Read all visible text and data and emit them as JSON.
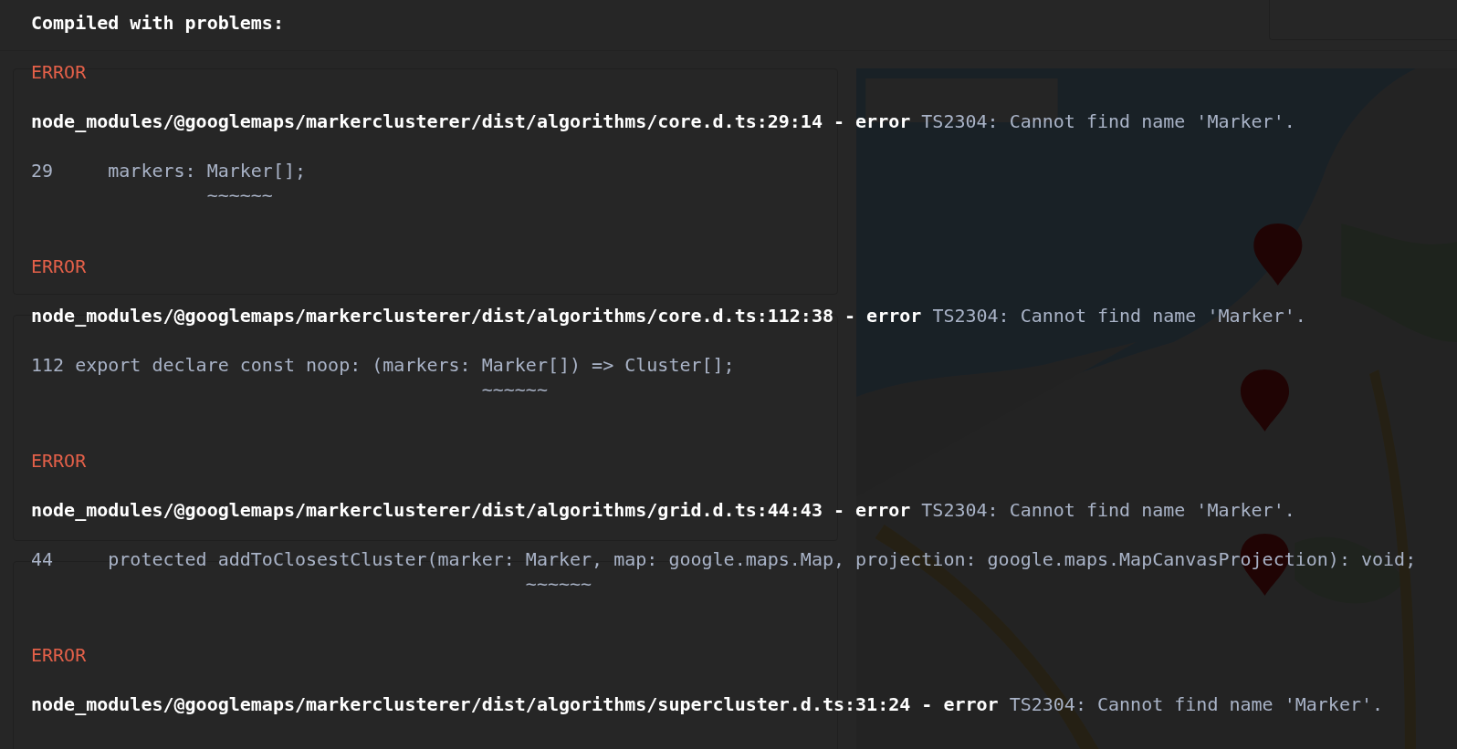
{
  "overlay": {
    "title": "Compiled with problems:",
    "errors": [
      {
        "label": "ERROR",
        "location": "node_modules/@googlemaps/markerclusterer/dist/algorithms/core.d.ts:29:14",
        "severity": "- error",
        "message": "TS2304: Cannot find name 'Marker'.",
        "code": "29     markers: Marker[];",
        "underline": "                ~~~~~~"
      },
      {
        "label": "ERROR",
        "location": "node_modules/@googlemaps/markerclusterer/dist/algorithms/core.d.ts:112:38",
        "severity": "- error",
        "message": "TS2304: Cannot find name 'Marker'.",
        "code": "112 export declare const noop: (markers: Marker[]) => Cluster[];",
        "underline": "                                         ~~~~~~"
      },
      {
        "label": "ERROR",
        "location": "node_modules/@googlemaps/markerclusterer/dist/algorithms/grid.d.ts:44:43",
        "severity": "- error",
        "message": "TS2304: Cannot find name 'Marker'.",
        "code": "44     protected addToClosestCluster(marker: Marker, map: google.maps.Map, projection: google.maps.MapCanvasProjection): void;",
        "underline": "                                             ~~~~~~"
      },
      {
        "label": "ERROR",
        "location": "node_modules/@googlemaps/markerclusterer/dist/algorithms/supercluster.d.ts:31:24",
        "severity": "- error",
        "message": "TS2304: Cannot find name 'Marker'."
      }
    ]
  }
}
